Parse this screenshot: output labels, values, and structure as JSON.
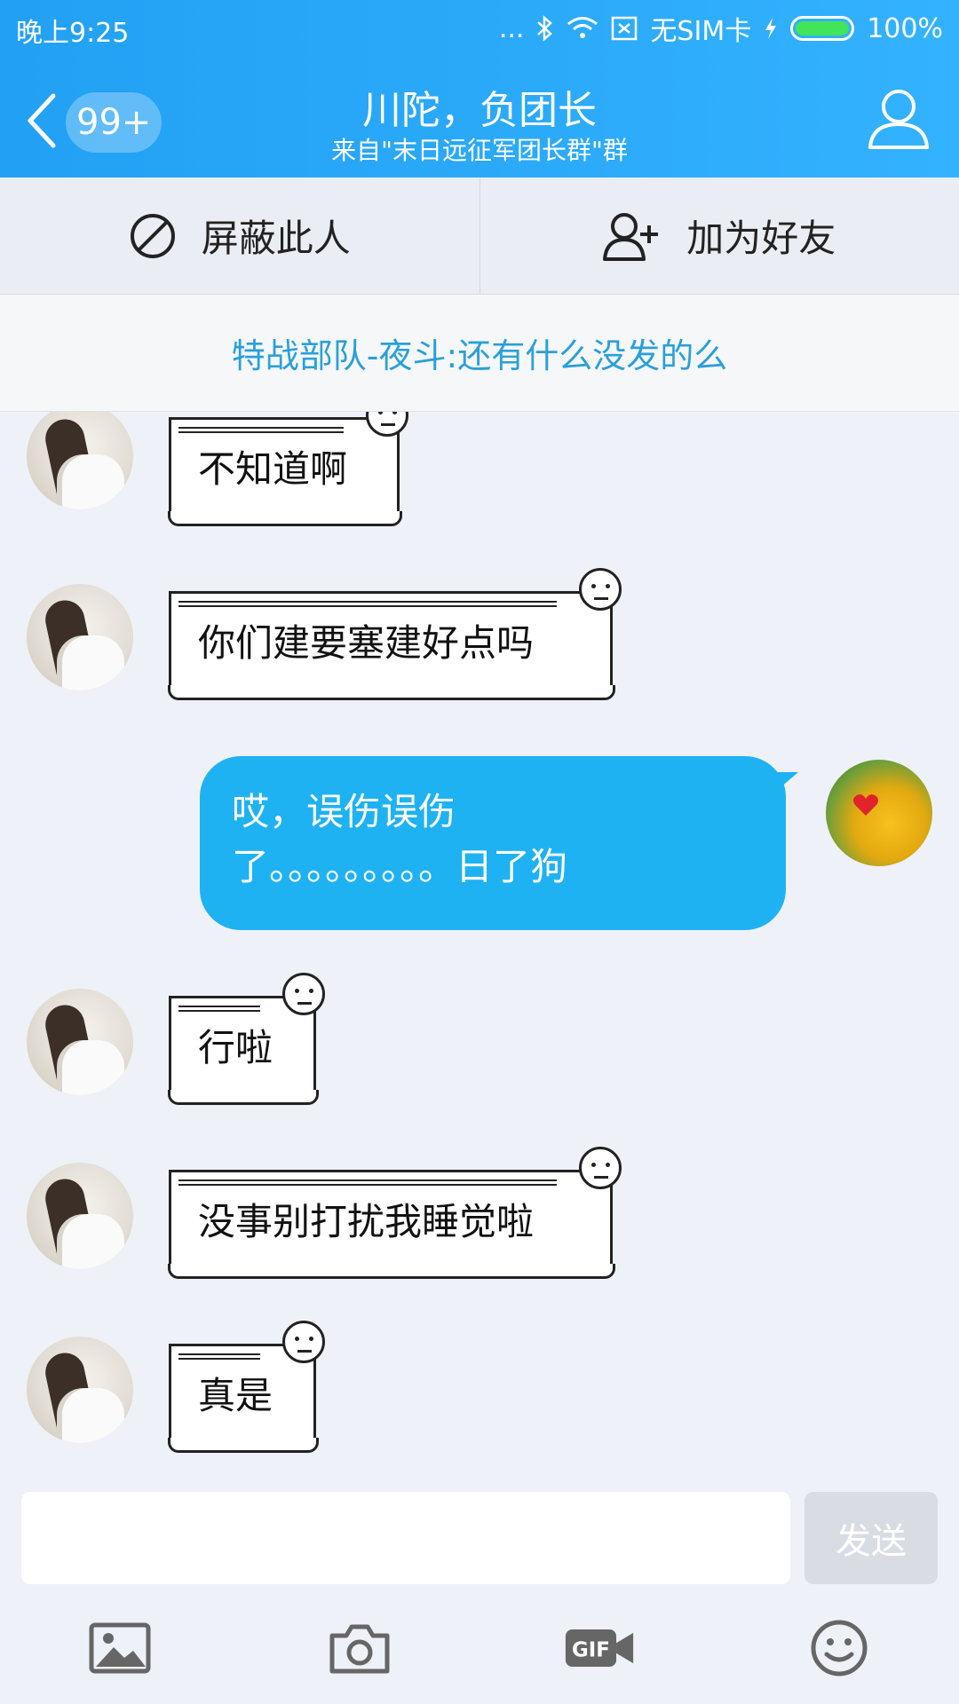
{
  "status": {
    "time": "晚上9:25",
    "dots": "...",
    "sim": "无SIM卡",
    "battery": "100%"
  },
  "header": {
    "badge": "99+",
    "title": "川陀，负团长",
    "subtitle": "来自\"末日远征军团长群\"群"
  },
  "actions": {
    "block": "屏蔽此人",
    "add_friend": "加为好友"
  },
  "pinned": "特战部队-夜斗:还有什么没发的么",
  "messages": [
    {
      "text": "不知道啊",
      "from": "other"
    },
    {
      "text": "你们建要塞建好点吗",
      "from": "other"
    },
    {
      "line1": "哎，误伤误伤",
      "line2": "了。。。。。。。。。日了狗",
      "from": "me"
    },
    {
      "text": "行啦",
      "from": "other"
    },
    {
      "text": "没事别打扰我睡觉啦",
      "from": "other"
    },
    {
      "text": "真是",
      "from": "other"
    }
  ],
  "input": {
    "value": "",
    "send": "发送"
  },
  "toolbar_icons": [
    "image-icon",
    "camera-icon",
    "gif-icon",
    "emoji-icon"
  ],
  "colors": {
    "header": "#22a0f3",
    "pinned_text": "#2aa0d8",
    "my_bubble": "#1fb2f2"
  }
}
